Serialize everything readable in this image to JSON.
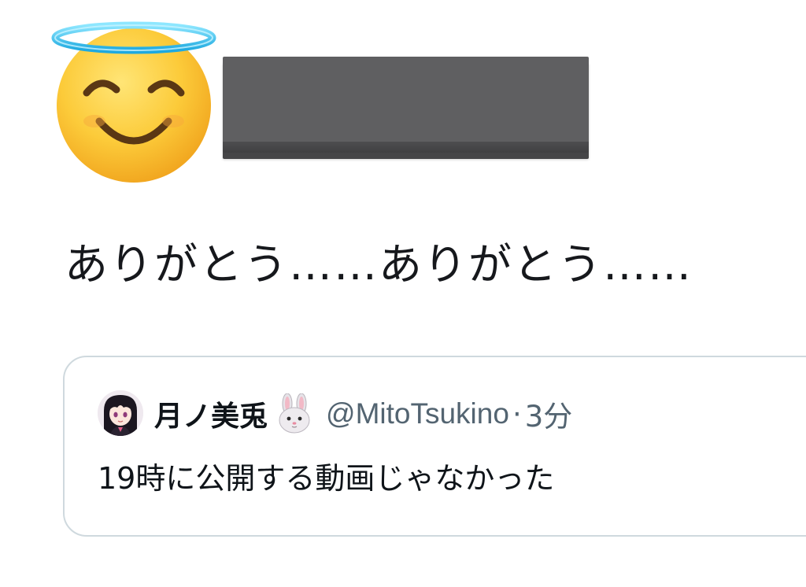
{
  "tweet": {
    "avatar_icon": "smiling-face-with-halo-icon",
    "text": "ありがとう……ありがとう……"
  },
  "quote": {
    "avatar_icon": "user-avatar",
    "name": "月ノ美兎",
    "name_emoji": "rabbit-face-icon",
    "handle": "@MitoTsukino",
    "separator": "·",
    "time": "3分",
    "text": "19時に公開する動画じゃなかった"
  },
  "colors": {
    "border": "#cfd9de",
    "secondary_text": "#536471",
    "halo": "#2fc3ef",
    "redaction": "#5f5f61"
  }
}
